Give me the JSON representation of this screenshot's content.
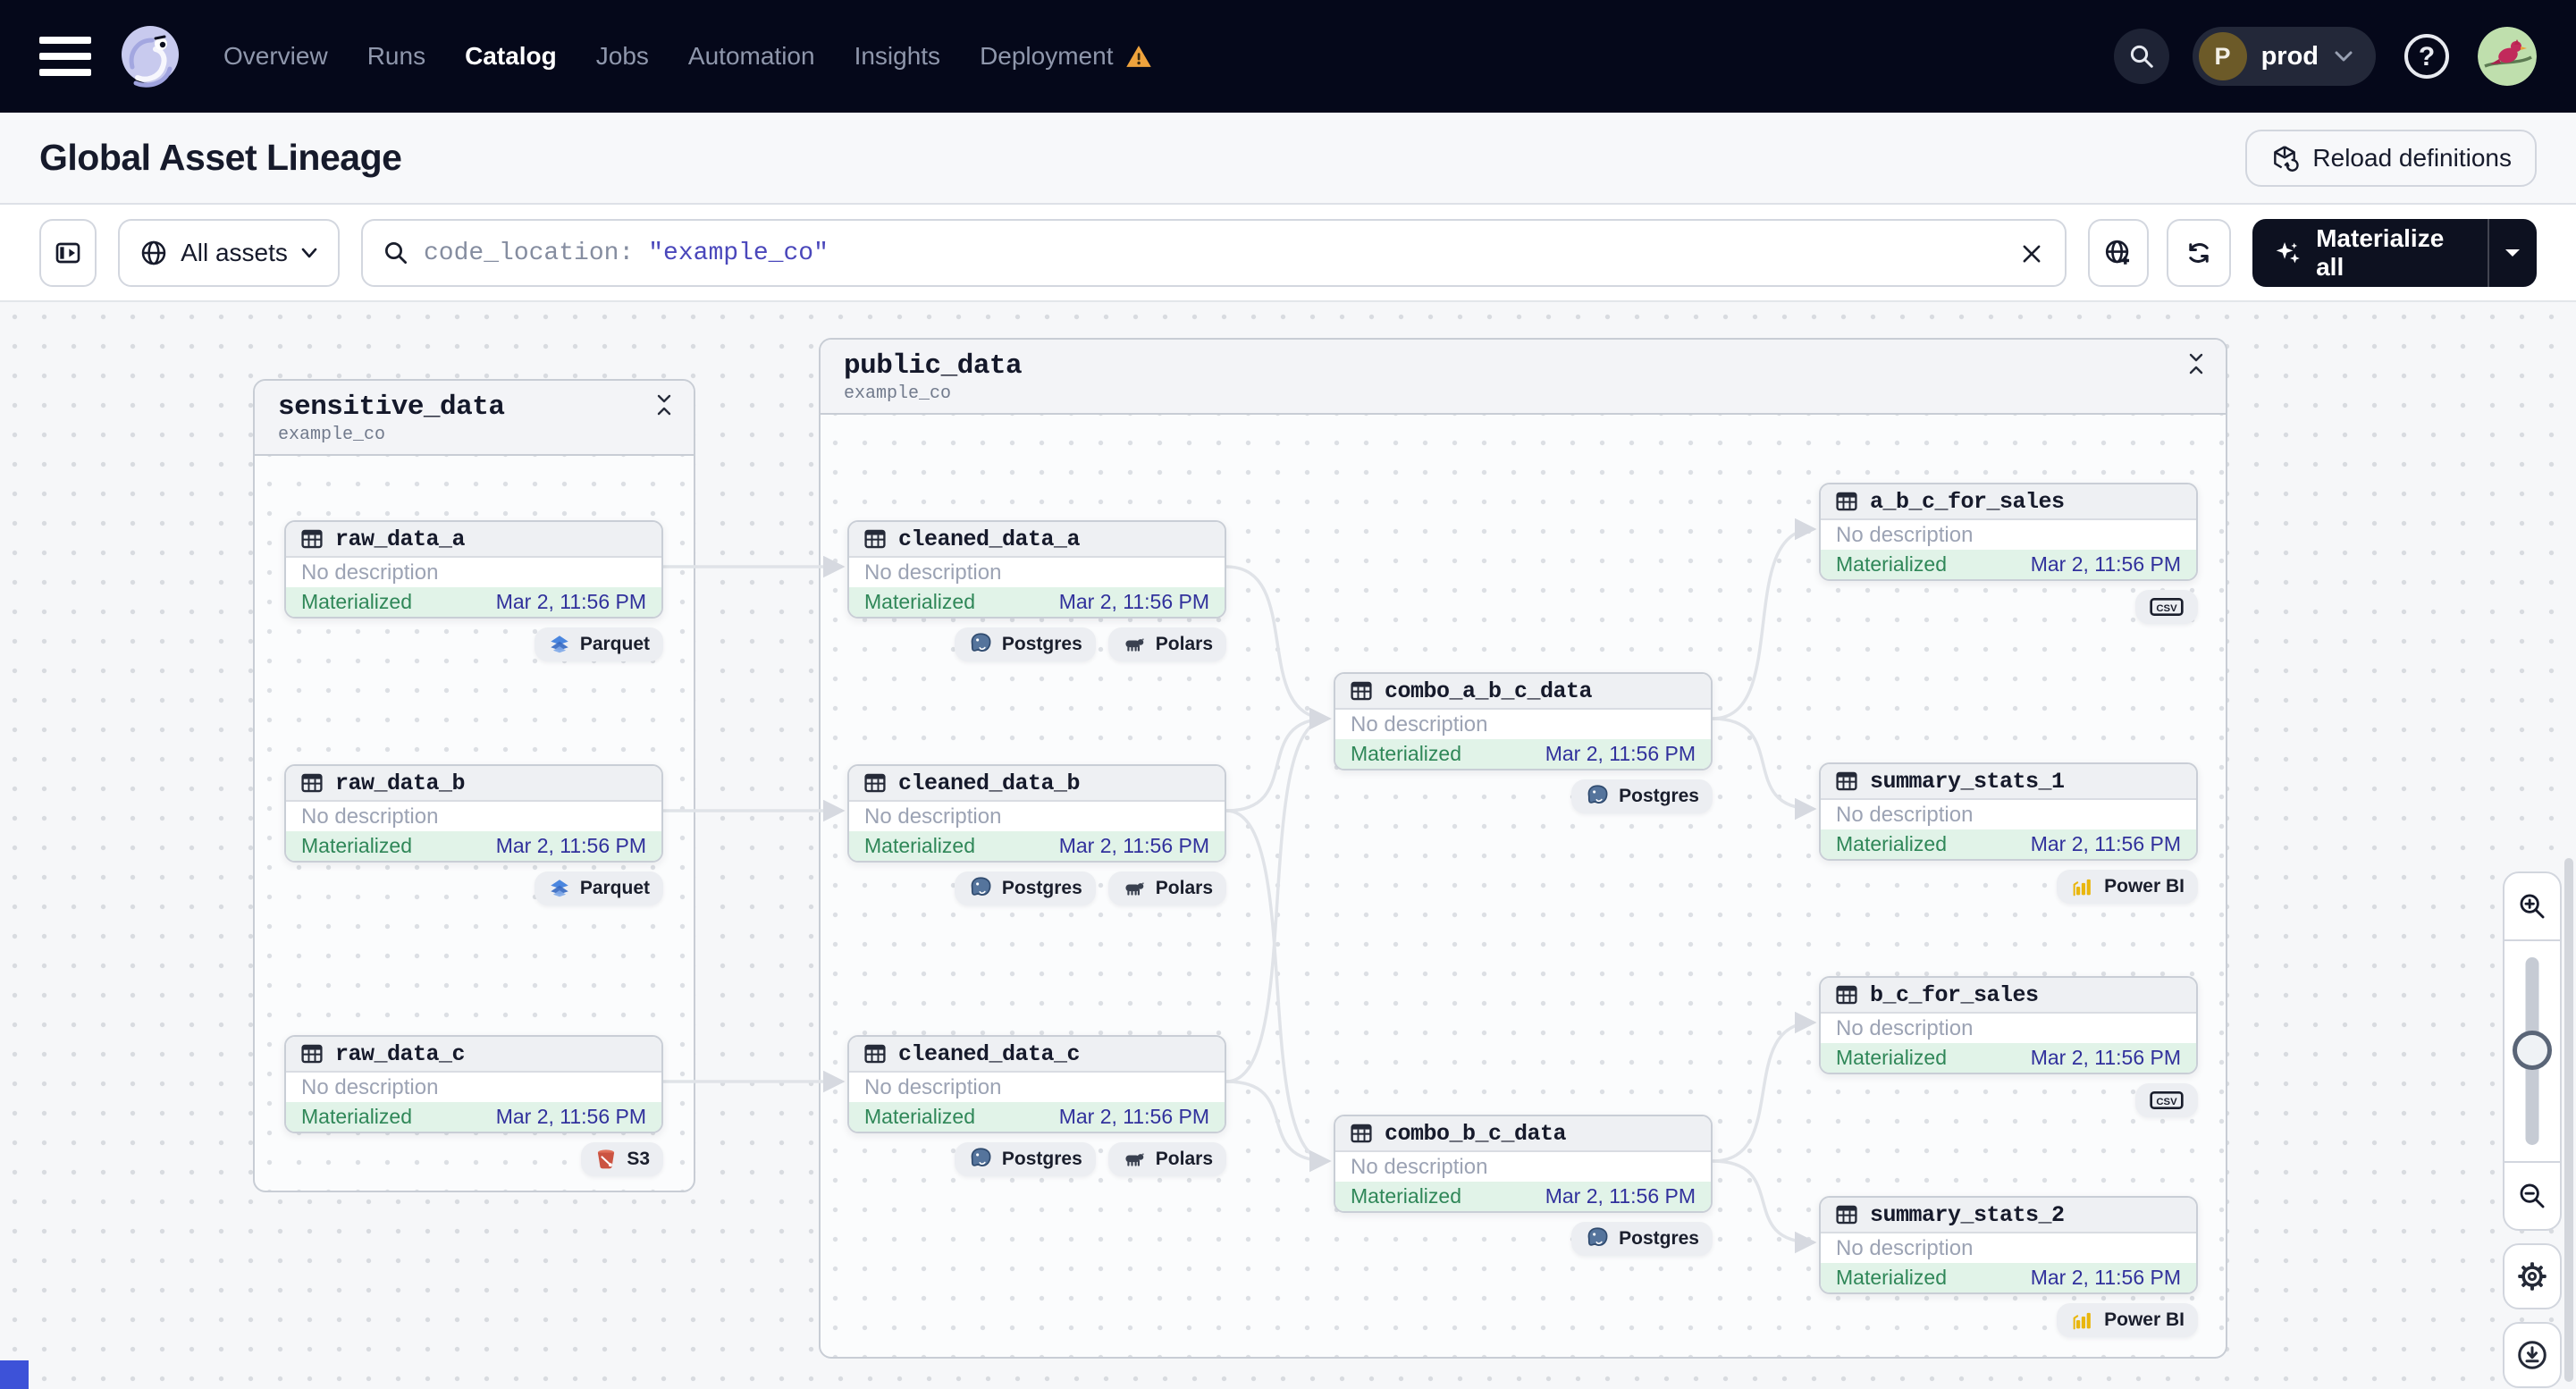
{
  "nav": {
    "items": [
      {
        "label": "Overview"
      },
      {
        "label": "Runs"
      },
      {
        "label": "Catalog"
      },
      {
        "label": "Jobs"
      },
      {
        "label": "Automation"
      },
      {
        "label": "Insights"
      },
      {
        "label": "Deployment",
        "warning": true
      }
    ],
    "active": "Catalog",
    "environment": {
      "initial": "P",
      "label": "prod"
    }
  },
  "header": {
    "title": "Global Asset Lineage",
    "reload_label": "Reload definitions"
  },
  "toolbar": {
    "filter_label": "All assets",
    "search_prefix": "code_location:",
    "search_value": "\"example_co\"",
    "materialize_label": "Materialize all"
  },
  "graph": {
    "no_description": "No description",
    "status_label": "Materialized",
    "timestamp": "Mar 2, 11:56 PM",
    "groups": [
      {
        "name": "sensitive_data",
        "location": "example_co"
      },
      {
        "name": "public_data",
        "location": "example_co"
      }
    ],
    "nodes": [
      {
        "name": "raw_data_a",
        "group": "sensitive_data",
        "badges": [
          {
            "type": "parquet",
            "label": "Parquet"
          }
        ]
      },
      {
        "name": "raw_data_b",
        "group": "sensitive_data",
        "badges": [
          {
            "type": "parquet",
            "label": "Parquet"
          }
        ]
      },
      {
        "name": "raw_data_c",
        "group": "sensitive_data",
        "badges": [
          {
            "type": "s3",
            "label": "S3"
          }
        ]
      },
      {
        "name": "cleaned_data_a",
        "group": "public_data",
        "badges": [
          {
            "type": "postgres",
            "label": "Postgres"
          },
          {
            "type": "polars",
            "label": "Polars"
          }
        ]
      },
      {
        "name": "cleaned_data_b",
        "group": "public_data",
        "badges": [
          {
            "type": "postgres",
            "label": "Postgres"
          },
          {
            "type": "polars",
            "label": "Polars"
          }
        ]
      },
      {
        "name": "cleaned_data_c",
        "group": "public_data",
        "badges": [
          {
            "type": "postgres",
            "label": "Postgres"
          },
          {
            "type": "polars",
            "label": "Polars"
          }
        ]
      },
      {
        "name": "combo_a_b_c_data",
        "group": "public_data",
        "badges": [
          {
            "type": "postgres",
            "label": "Postgres"
          }
        ]
      },
      {
        "name": "combo_b_c_data",
        "group": "public_data",
        "badges": [
          {
            "type": "postgres",
            "label": "Postgres"
          }
        ]
      },
      {
        "name": "a_b_c_for_sales",
        "group": "public_data",
        "badges": [
          {
            "type": "csv",
            "label": ""
          }
        ]
      },
      {
        "name": "summary_stats_1",
        "group": "public_data",
        "badges": [
          {
            "type": "powerbi",
            "label": "Power BI"
          }
        ]
      },
      {
        "name": "b_c_for_sales",
        "group": "public_data",
        "badges": [
          {
            "type": "csv",
            "label": ""
          }
        ]
      },
      {
        "name": "summary_stats_2",
        "group": "public_data",
        "badges": [
          {
            "type": "powerbi",
            "label": "Power BI"
          }
        ]
      }
    ],
    "edges": [
      [
        "raw_data_a",
        "cleaned_data_a"
      ],
      [
        "raw_data_b",
        "cleaned_data_b"
      ],
      [
        "raw_data_c",
        "cleaned_data_c"
      ],
      [
        "cleaned_data_a",
        "combo_a_b_c_data"
      ],
      [
        "cleaned_data_b",
        "combo_a_b_c_data"
      ],
      [
        "cleaned_data_c",
        "combo_a_b_c_data"
      ],
      [
        "cleaned_data_b",
        "combo_b_c_data"
      ],
      [
        "cleaned_data_c",
        "combo_b_c_data"
      ],
      [
        "combo_a_b_c_data",
        "a_b_c_for_sales"
      ],
      [
        "combo_a_b_c_data",
        "summary_stats_1"
      ],
      [
        "combo_b_c_data",
        "b_c_for_sales"
      ],
      [
        "combo_b_c_data",
        "summary_stats_2"
      ]
    ]
  },
  "colors": {
    "status_green": "#2F8758",
    "timestamp_indigo": "#31319C",
    "query_indigo": "#4A47BB",
    "warning_orange": "#EFA33D",
    "edge_gray": "#E0E3E8"
  }
}
